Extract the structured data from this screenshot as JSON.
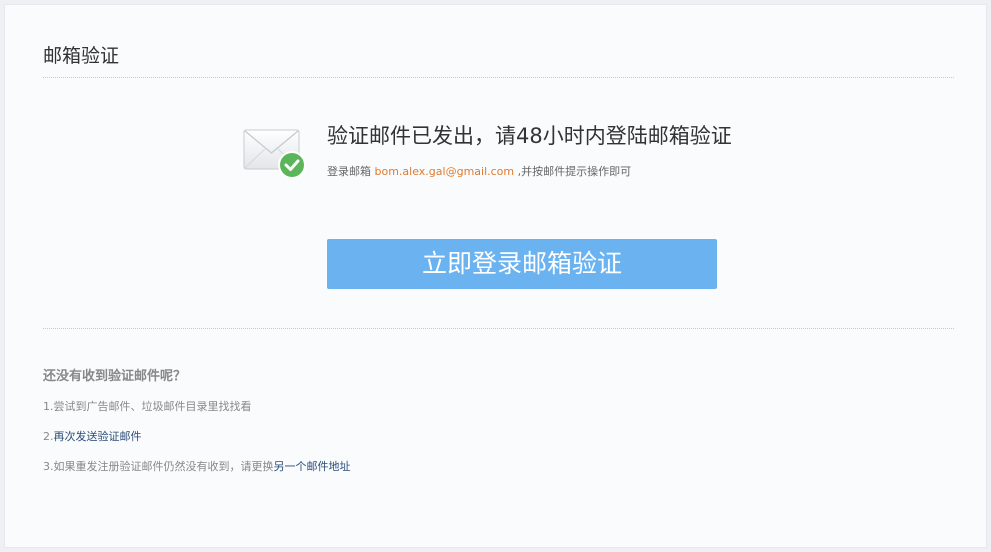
{
  "page_title": "邮箱验证",
  "notice": {
    "headline": "验证邮件已发出，请48小时内登陆邮箱验证",
    "sub_prefix": "登录邮箱 ",
    "email": "bom.alex.gal@gmail.com",
    "sub_suffix": " ,并按邮件提示操作即可"
  },
  "login_button_label": "立即登录邮箱验证",
  "help": {
    "title": "还没有收到验证邮件呢？",
    "line1": "1.尝试到广告邮件、垃圾邮件目录里找找看",
    "line2_prefix": "2.",
    "line2_link": "再次发送验证邮件",
    "line3_prefix": "3.如果重发注册验证邮件仍然没有收到，请更换",
    "line3_link": "另一个邮件地址"
  },
  "icons": {
    "envelope": "mail-envelope-icon",
    "check": "green-check-badge-icon"
  },
  "colors": {
    "button": "#6ab3f0",
    "email": "#e07a2e",
    "link": "#2a4c78",
    "check": "#5bb65a"
  }
}
